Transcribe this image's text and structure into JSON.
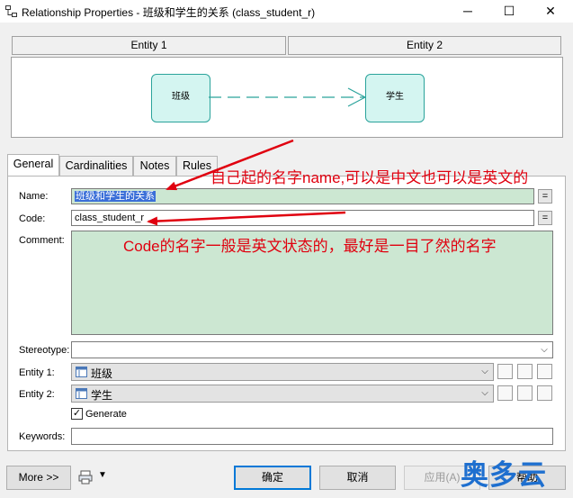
{
  "window": {
    "title": "Relationship Properties - 班级和学生的关系 (class_student_r)",
    "minimize": "─",
    "maximize": "☐",
    "close": "✕"
  },
  "entities": {
    "header1": "Entity 1",
    "header2": "Entity 2",
    "box1": "班级",
    "box2": "学生"
  },
  "tabs": [
    "General",
    "Cardinalities",
    "Notes",
    "Rules"
  ],
  "form": {
    "name_label": "Name:",
    "name_value": "班级和学生的关系",
    "code_label": "Code:",
    "code_value": "class_student_r",
    "comment_label": "Comment:",
    "stereotype_label": "Stereotype:",
    "stereotype_value": "",
    "entity1_label": "Entity 1:",
    "entity1_value": "班级",
    "entity2_label": "Entity 2:",
    "entity2_value": "学生",
    "generate_label": "Generate",
    "generate_checked": true,
    "keywords_label": "Keywords:",
    "keywords_value": "",
    "eq_button": "="
  },
  "annotations": {
    "note_name": "自己起的名字name,可以是中文也可以是英文的",
    "note_code": "Code的名字一般是英文状态的，最好是一目了然的名字"
  },
  "buttons": {
    "more": "More >>",
    "ok": "确定",
    "cancel": "取消",
    "apply": "应用(A)",
    "help": "帮助"
  },
  "watermark": "奥多云",
  "colors": {
    "highlight_green": "#cce7d2",
    "selection_blue": "#3a6fd8",
    "annotation_red": "#e0000f",
    "entity_fill": "#d4f5f1",
    "entity_border": "#2aa39b",
    "watermark_blue": "#1e6fcf"
  }
}
